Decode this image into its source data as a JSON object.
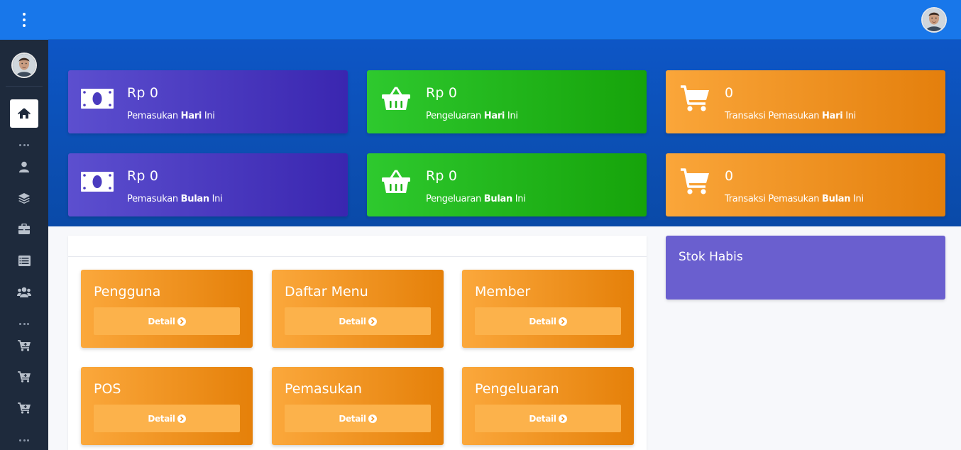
{
  "sidebar": {
    "menu_icon": "kebab-menu-icon",
    "avatar": "user-avatar",
    "items": [
      {
        "name": "home",
        "icon": "home-icon",
        "active": true
      },
      {
        "name": "user",
        "icon": "user-icon"
      },
      {
        "name": "layers",
        "icon": "layers-icon"
      },
      {
        "name": "briefcase",
        "icon": "briefcase-icon"
      },
      {
        "name": "list",
        "icon": "list-icon"
      },
      {
        "name": "users",
        "icon": "users-icon"
      },
      {
        "name": "cart-1",
        "icon": "cart-plus-icon"
      },
      {
        "name": "cart-2",
        "icon": "cart-plus-icon"
      },
      {
        "name": "cart-3",
        "icon": "cart-plus-icon"
      }
    ]
  },
  "topbar": {
    "avatar": "user-avatar"
  },
  "stats": {
    "income_today": {
      "value": "Rp 0",
      "label_pre": "Pemasukan ",
      "label_bold": "Hari",
      "label_post": " Ini",
      "icon": "money-bill-icon"
    },
    "expense_today": {
      "value": "Rp 0",
      "label_pre": "Pengeluaran ",
      "label_bold": "Hari",
      "label_post": " Ini",
      "icon": "basket-icon"
    },
    "transactions_today": {
      "value": "0",
      "label_pre": "Transaksi Pemasukan ",
      "label_bold": "Hari",
      "label_post": " Ini",
      "icon": "shopping-cart-icon"
    },
    "income_month": {
      "value": "Rp 0",
      "label_pre": "Pemasukan ",
      "label_bold": "Bulan",
      "label_post": " Ini",
      "icon": "money-bill-icon"
    },
    "expense_month": {
      "value": "Rp 0",
      "label_pre": "Pengeluaran ",
      "label_bold": "Bulan",
      "label_post": " Ini",
      "icon": "basket-icon"
    },
    "transactions_month": {
      "value": "0",
      "label_pre": "Transaksi Pemasukan ",
      "label_bold": "Bulan",
      "label_post": " Ini",
      "icon": "shopping-cart-icon"
    }
  },
  "menu": {
    "detail_label": "Detail",
    "cards": [
      {
        "title": "Pengguna"
      },
      {
        "title": "Daftar Menu"
      },
      {
        "title": "Member"
      },
      {
        "title": "POS"
      },
      {
        "title": "Pemasukan"
      },
      {
        "title": "Pengeluaran"
      }
    ]
  },
  "stok": {
    "title": "Stok Habis"
  },
  "colors": {
    "primary": "#1877ea",
    "sidebar": "#1e2a3c",
    "purple": "#3a26b0",
    "green": "#16a30a",
    "orange": "#e47f0c",
    "stok": "#6a5fcf"
  }
}
